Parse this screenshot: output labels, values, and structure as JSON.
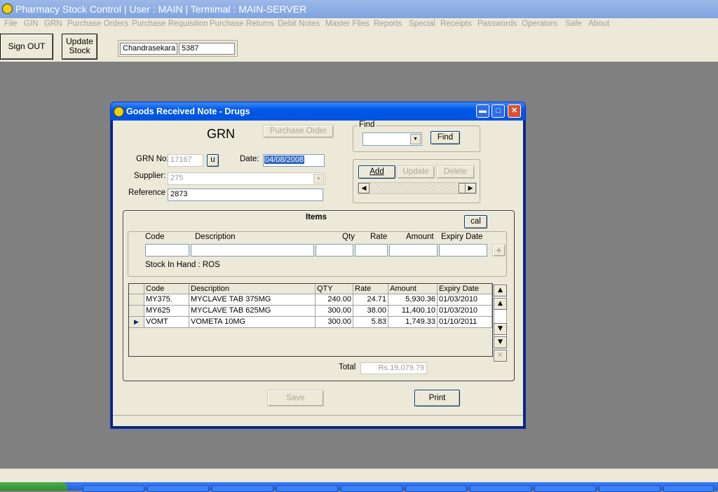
{
  "app": {
    "title": "Pharmacy Stock Control  |  User : MAIN  |  Termimal : MAIN-SERVER",
    "menu": [
      "File",
      "GIN",
      "GRN",
      "Purchase Orders",
      "Purchase Requisition",
      "Purchase Returns",
      "Debit Notes",
      "Master Files",
      "Reports",
      "Special",
      "Receipts",
      "Passwords",
      "Operators",
      "Safe",
      "About"
    ]
  },
  "toolbar": {
    "sign_out": "Sign OUT",
    "update_stock_1": "Update",
    "update_stock_2": "Stock",
    "user_name": "Chandrasekara",
    "user_code": "5387"
  },
  "dialog": {
    "title": "Goods Received Note - Drugs",
    "heading": "GRN",
    "purchase_order_btn": "Purchase Order",
    "grn_no_label": "GRN No:",
    "grn_no": "17167",
    "u_btn": "u",
    "date_label": "Date:",
    "date": "04/08/2008",
    "supplier_label": "Supplier:",
    "supplier": "275",
    "reference_label": "Reference",
    "reference": "2873",
    "find": {
      "legend": "Find",
      "value": "",
      "button": "Find"
    },
    "actions": {
      "add": "Add",
      "update": "Update",
      "delete": "Delete"
    },
    "items": {
      "title": "Items",
      "cal_btn": "cal",
      "entry_headers": {
        "code": "Code",
        "description": "Description",
        "qty": "Qty",
        "rate": "Rate",
        "amount": "Amount",
        "expiry": "Expiry Date"
      },
      "stock_in_hand": "Stock In Hand :  ROS",
      "grid_headers": {
        "code": "Code",
        "description": "Description",
        "qty": "QTY",
        "rate": "Rate",
        "amount": "Amount",
        "expiry": "Expiry Date"
      },
      "rows": [
        {
          "code": "MY375.",
          "description": "MYCLAVE TAB 375MG",
          "qty": "240.00",
          "rate": "24.71",
          "amount": "5,930.36",
          "expiry": "01/03/2010"
        },
        {
          "code": "MY625",
          "description": "MYCLAVE TAB 625MG",
          "qty": "300.00",
          "rate": "38.00",
          "amount": "11,400.10",
          "expiry": "01/03/2010"
        },
        {
          "code": "VOMT",
          "description": "VOMETA 10MG",
          "qty": "300.00",
          "rate": "5.83",
          "amount": "1,749.33",
          "expiry": "01/10/2011"
        }
      ],
      "total_label": "Total",
      "total": "Rs.19,079.79"
    },
    "save_btn": "Save",
    "print_btn": "Print"
  },
  "colors": {
    "title_bar": "#0058e6",
    "menu_disabled": "#a0a0a0",
    "desktop": "#808080",
    "selection": "#316ac5"
  }
}
